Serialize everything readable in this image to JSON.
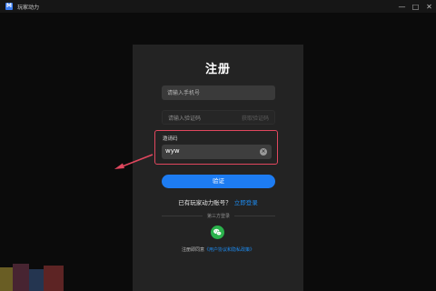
{
  "window": {
    "app_icon_text": "M",
    "title": "玩家动力",
    "controls": {
      "minimize": "—",
      "maximize": "□",
      "close": "✕"
    }
  },
  "register_panel": {
    "title": "注册",
    "phone_placeholder": "请输入手机号",
    "code_placeholder": "请输入验证码",
    "get_code_label": "获取验证码",
    "invite_label": "邀请码",
    "invite_value": "wyw",
    "register_button": "验证",
    "has_account_text": "已有玩家动力账号？",
    "login_link": "立即登录",
    "third_party_label": "第三方登录",
    "agreement_text": "注册即同意",
    "agreement_link": "《用户协议和隐私政策》"
  },
  "icons": {
    "clear": "clear-icon",
    "wechat": "wechat-icon",
    "annotation_arrow": "arrow-icon"
  },
  "colors": {
    "accent_blue": "#1d7cf2",
    "highlight_red": "#e0475e",
    "wechat_green": "#2bb24c",
    "panel_bg": "#232323"
  }
}
